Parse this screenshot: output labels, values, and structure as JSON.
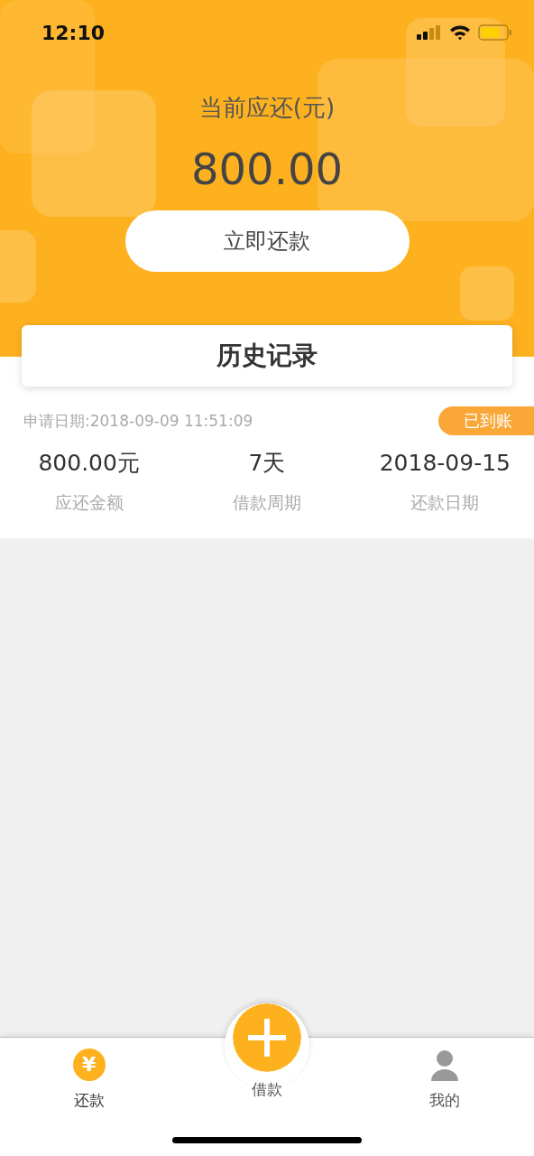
{
  "status_bar": {
    "time": "12:10"
  },
  "header": {
    "title": "当前应还(元)",
    "amount": "800.00",
    "button": "立即还款"
  },
  "history": {
    "title": "历史记录"
  },
  "records": [
    {
      "apply_date": "申请日期:2018-09-09 11:51:09",
      "status": "已到账",
      "fields": [
        {
          "value": "800.00元",
          "label": "应还金额"
        },
        {
          "value": "7天",
          "label": "借款周期"
        },
        {
          "value": "2018-09-15",
          "label": "还款日期"
        }
      ]
    }
  ],
  "tab_bar": [
    {
      "kind": "yen",
      "icon_text": "¥",
      "label": "还款",
      "selected": true
    },
    {
      "kind": "plus",
      "label": "借款",
      "selected": false
    },
    {
      "kind": "person",
      "label": "我的",
      "selected": false
    }
  ]
}
